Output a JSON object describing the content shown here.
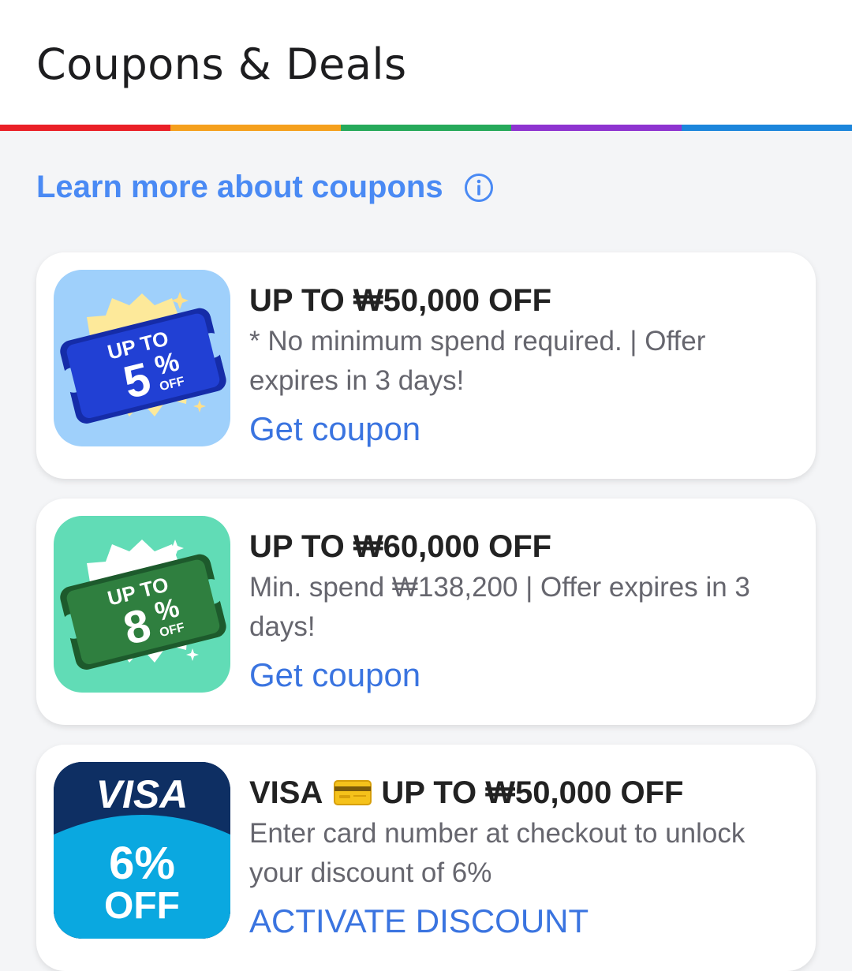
{
  "header": {
    "title": "Coupons & Deals"
  },
  "rainbow_colors": [
    "#ea2027",
    "#f5a01d",
    "#26a95a",
    "#8e34d0",
    "#1c86dc"
  ],
  "learn_more": {
    "label": "Learn more about coupons",
    "icon": "info-icon"
  },
  "coupons": [
    {
      "badge_top": "UP TO",
      "badge_value": "5",
      "badge_pct": "%",
      "badge_off": "OFF",
      "title": "UP TO ₩50,000 OFF",
      "description": "* No minimum spend required. | Offer expires in 3 days!",
      "action": "Get coupon"
    },
    {
      "badge_top": "UP TO",
      "badge_value": "8",
      "badge_pct": "%",
      "badge_off": "OFF",
      "title": "UP TO ₩60,000 OFF",
      "description": "Min. spend ₩138,200 | Offer expires in 3 days!",
      "action": "Get coupon"
    },
    {
      "badge_brand": "VISA",
      "badge_value": "6%",
      "badge_off": "OFF",
      "title_brand": "VISA",
      "title": "UP TO ₩50,000 OFF",
      "description": "Enter card number at checkout to unlock your discount of 6%",
      "action": "ACTIVATE DISCOUNT"
    }
  ]
}
